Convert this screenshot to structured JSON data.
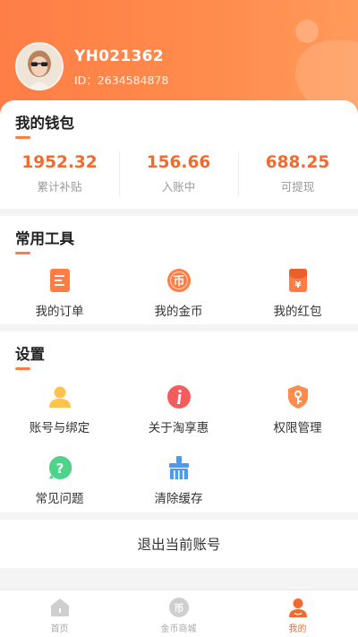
{
  "user": {
    "name": "YH021362",
    "id_text": "ID：2634584878"
  },
  "wallet": {
    "title": "我的钱包",
    "stats": [
      {
        "value": "1952.32",
        "label": "累计补贴"
      },
      {
        "value": "156.66",
        "label": "入账中"
      },
      {
        "value": "688.25",
        "label": "可提现"
      }
    ]
  },
  "tools": {
    "title": "常用工具",
    "items": [
      {
        "label": "我的订单",
        "icon": "order-icon"
      },
      {
        "label": "我的金币",
        "icon": "coin-icon"
      },
      {
        "label": "我的红包",
        "icon": "red-packet-icon"
      }
    ]
  },
  "settings": {
    "title": "设置",
    "items": [
      {
        "label": "账号与绑定",
        "icon": "account-icon"
      },
      {
        "label": "关于淘享惠",
        "icon": "info-icon"
      },
      {
        "label": "权限管理",
        "icon": "shield-key-icon"
      },
      {
        "label": "常见问题",
        "icon": "question-icon"
      },
      {
        "label": "清除缓存",
        "icon": "broom-icon"
      }
    ]
  },
  "logout": {
    "label": "退出当前账号"
  },
  "tabbar": {
    "tabs": [
      {
        "label": "首页",
        "icon": "home-icon",
        "active": false
      },
      {
        "label": "金币商城",
        "icon": "coin-mall-icon",
        "active": false
      },
      {
        "label": "我的",
        "icon": "profile-icon",
        "active": true
      }
    ]
  },
  "colors": {
    "accent": "#ff7d45",
    "value_text": "#f26a30"
  }
}
